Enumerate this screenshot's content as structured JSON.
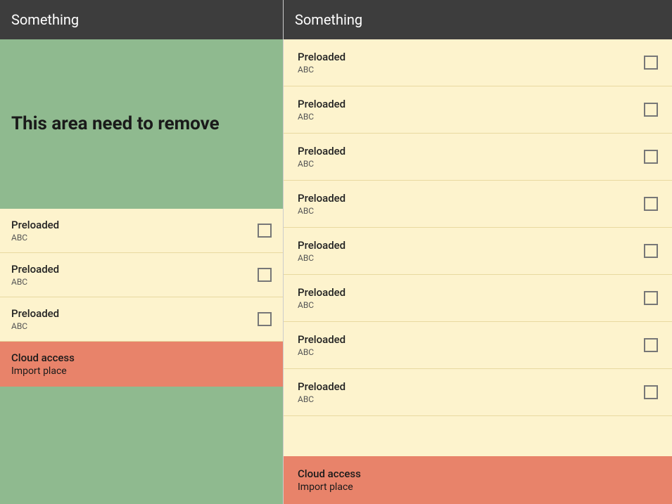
{
  "left": {
    "header": {
      "title": "Something"
    },
    "green_area_text": "This area need to remove",
    "list_items": [
      {
        "title": "Preloaded",
        "subtitle": "ABC"
      },
      {
        "title": "Preloaded",
        "subtitle": "ABC"
      },
      {
        "title": "Preloaded",
        "subtitle": "ABC"
      }
    ],
    "footer": {
      "line1": "Cloud access",
      "line2": "Import place"
    }
  },
  "right": {
    "header": {
      "title": "Something"
    },
    "list_items": [
      {
        "title": "Preloaded",
        "subtitle": "ABC"
      },
      {
        "title": "Preloaded",
        "subtitle": "ABC"
      },
      {
        "title": "Preloaded",
        "subtitle": "ABC"
      },
      {
        "title": "Preloaded",
        "subtitle": "ABC"
      },
      {
        "title": "Preloaded",
        "subtitle": "ABC"
      },
      {
        "title": "Preloaded",
        "subtitle": "ABC"
      },
      {
        "title": "Preloaded",
        "subtitle": "ABC"
      },
      {
        "title": "Preloaded",
        "subtitle": "ABC"
      }
    ],
    "footer": {
      "line1": "Cloud access",
      "line2": "Import place"
    }
  }
}
